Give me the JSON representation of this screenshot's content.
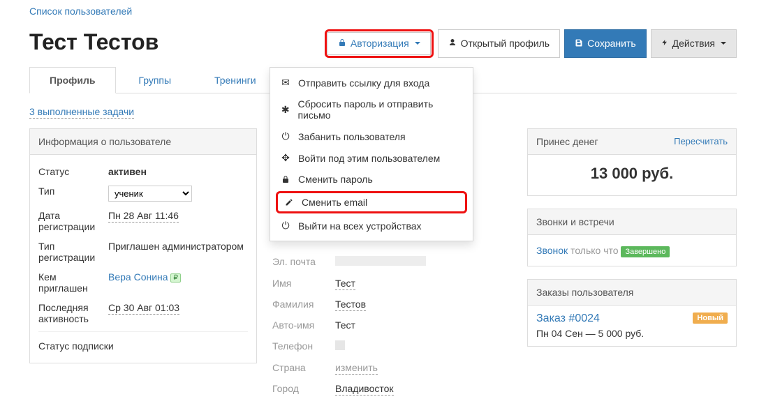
{
  "breadcrumb": "Список пользователей",
  "page_title": "Тест Тестов",
  "header": {
    "auth_label": "Авторизация",
    "open_profile_label": "Открытый профиль",
    "save_label": "Сохранить",
    "actions_label": "Действия"
  },
  "tabs": {
    "profile": "Профиль",
    "groups": "Группы",
    "trainings": "Тренинги"
  },
  "tasks_link": "3 выполненные задачи",
  "info_panel": {
    "title": "Информация о пользователе",
    "rows": {
      "status_label": "Статус",
      "status_value": "активен",
      "type_label": "Тип",
      "type_value": "ученик",
      "reg_date_label": "Дата регистрации",
      "reg_date_value": "Пн 28 Авг 11:46",
      "reg_type_label": "Тип регистрации",
      "reg_type_value": "Приглашен администратором",
      "invited_by_label": "Кем приглашен",
      "invited_by_value": "Вера Сонина",
      "last_activity_label": "Последняя активность",
      "last_activity_value": "Ср 30 Авг 01:03",
      "subscription_label": "Статус подписки"
    }
  },
  "dropdown": {
    "send_link": "Отправить ссылку для входа",
    "reset_pw": "Сбросить пароль и отправить письмо",
    "ban_user": "Забанить пользователя",
    "login_as": "Войти под этим пользователем",
    "change_pw": "Сменить пароль",
    "change_email": "Сменить email",
    "logout_all": "Выйти на всех устройствах"
  },
  "identity": {
    "full_name": "Тест Тестов",
    "email_label": "Эл. почта",
    "first_name_label": "Имя",
    "first_name_value": "Тест",
    "last_name_label": "Фамилия",
    "last_name_value": "Тестов",
    "auto_name_label": "Авто-имя",
    "auto_name_value": "Тест",
    "phone_label": "Телефон",
    "country_label": "Страна",
    "country_value": "изменить",
    "city_label": "Город",
    "city_value": "Владивосток"
  },
  "money_panel": {
    "title": "Принес денег",
    "recalc": "Пересчитать",
    "amount": "13 000 руб."
  },
  "calls_panel": {
    "title": "Звонки и встречи",
    "call_link": "Звонок",
    "just_now": "только что",
    "status": "Завершено"
  },
  "orders_panel": {
    "title": "Заказы пользователя",
    "order_link": "Заказ #0024",
    "order_date": "Пн 04 Сен — 5 000 руб.",
    "badge": "Новый"
  }
}
